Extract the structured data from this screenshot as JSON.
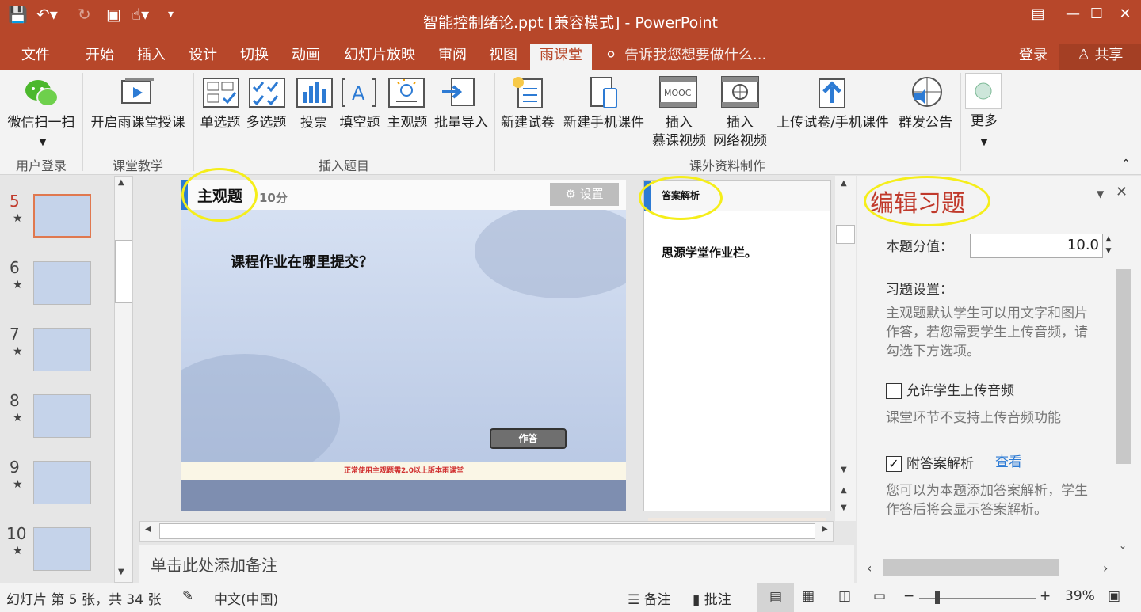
{
  "window": {
    "title": "智能控制绪论.ppt [兼容模式] - PowerPoint"
  },
  "tabs": [
    {
      "label": "文件"
    },
    {
      "label": "开始"
    },
    {
      "label": "插入"
    },
    {
      "label": "设计"
    },
    {
      "label": "切换"
    },
    {
      "label": "动画"
    },
    {
      "label": "幻灯片放映"
    },
    {
      "label": "审阅"
    },
    {
      "label": "视图"
    },
    {
      "label": "雨课堂"
    }
  ],
  "tell_me": "告诉我您想要做什么...",
  "login": "登录",
  "share": "共享",
  "ribbon": {
    "wechat_scan": "微信扫一扫",
    "start_class": "开启雨课堂授课",
    "single_choice": "单选题",
    "multi_choice": "多选题",
    "vote": "投票",
    "fill_blank": "填空题",
    "subjective": "主观题",
    "batch_import": "批量导入",
    "new_exam": "新建试卷",
    "new_mobile": "新建手机课件",
    "insert_mooc_1": "插入",
    "insert_mooc_2": "慕课视频",
    "insert_web_1": "插入",
    "insert_web_2": "网络视频",
    "upload": "上传试卷/手机课件",
    "broadcast": "群发公告",
    "more": "更多",
    "mooc_icon_text": "MOOC",
    "groups": {
      "login": "用户登录",
      "teach": "课堂教学",
      "insert": "插入题目",
      "extra": "课外资料制作"
    }
  },
  "thumbs": [
    {
      "num": "5",
      "star": "★"
    },
    {
      "num": "6",
      "star": "★"
    },
    {
      "num": "7",
      "star": "★"
    },
    {
      "num": "8",
      "star": "★"
    },
    {
      "num": "9",
      "star": "★"
    },
    {
      "num": "10",
      "star": "★"
    }
  ],
  "slide": {
    "type_label": "主观题",
    "score": "10分",
    "settings": "设置",
    "question": "课程作业在哪里提交？",
    "answer_btn": "作答",
    "footer_note": "正常使用主观题需2.0以上版本雨课堂"
  },
  "answer_panel": {
    "title": "答案解析",
    "content": "思源学堂作业栏。"
  },
  "notes": "单击此处添加备注",
  "panel": {
    "title": "编辑习题",
    "score_label": "本题分值：",
    "score_value": "10.0",
    "settings_label": "习题设置：",
    "settings_desc_1": "主观题默认学生可以用文字和图片",
    "settings_desc_2": "作答，若您需要学生上传音频，请",
    "settings_desc_3": "勾选下方选项。",
    "allow_audio": "允许学生上传音频",
    "audio_note": "课堂环节不支持上传音频功能",
    "attach_answer": "附答案解析",
    "view": "查看",
    "answer_desc_1": "您可以为本题添加答案解析，学生",
    "answer_desc_2": "作答后将会显示答案解析。"
  },
  "status": {
    "slide_info": "幻灯片 第 5 张，共 34 张",
    "language": "中文(中国)",
    "notes": "备注",
    "comments": "批注",
    "zoom": "39%"
  },
  "colors": {
    "brand": "#b7472a",
    "highlight": "#f5ee1a",
    "panel_title": "#c0392b"
  }
}
